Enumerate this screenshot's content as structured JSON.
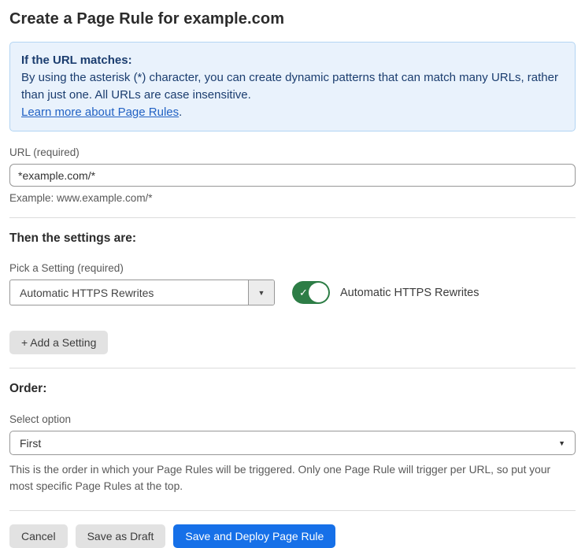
{
  "page": {
    "title": "Create a Page Rule for example.com"
  },
  "info_box": {
    "heading": "If the URL matches:",
    "body": "By using the asterisk (*) character, you can create dynamic patterns that can match many URLs, rather than just one. All URLs are case insensitive.",
    "link_label": "Learn more about Page Rules",
    "link_suffix": "."
  },
  "url_field": {
    "label": "URL (required)",
    "value": "*example.com/*",
    "helper": "Example: www.example.com/*"
  },
  "settings_section": {
    "heading": "Then the settings are:",
    "picker_label": "Pick a Setting (required)",
    "picker_value": "Automatic HTTPS Rewrites",
    "picker_arrow": "▼",
    "toggle_state": "on",
    "toggle_check": "✓",
    "toggle_label": "Automatic HTTPS Rewrites",
    "add_setting_label": "+ Add a Setting"
  },
  "order_section": {
    "heading": "Order:",
    "select_label": "Select option",
    "select_value": "First",
    "select_arrow": "▼",
    "helper": "This is the order in which your Page Rules will be triggered. Only one Page Rule will trigger per URL, so put your most specific Page Rules at the top."
  },
  "footer": {
    "cancel_label": "Cancel",
    "save_draft_label": "Save as Draft",
    "save_deploy_label": "Save and Deploy Page Rule"
  },
  "colors": {
    "info_bg": "#e9f2fc",
    "info_border": "#b3d5f3",
    "info_text": "#1b3d6f",
    "link": "#2262c4",
    "toggle_on_green": "#2d7d46",
    "primary_button_blue": "#1670e8",
    "secondary_button_gray": "#e2e2e2"
  }
}
